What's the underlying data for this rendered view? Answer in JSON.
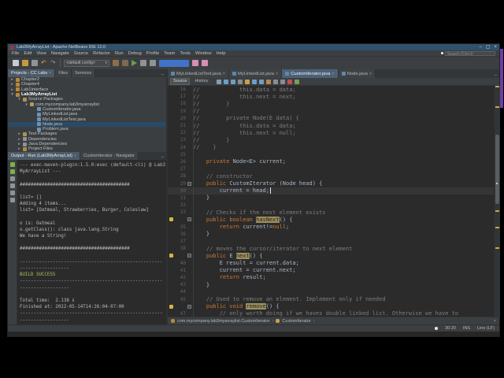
{
  "window": {
    "title": "Lab3MyArrayList - Apache NetBeans IDE 12.0"
  },
  "menu_bar": {
    "items": [
      "File",
      "Edit",
      "View",
      "Navigate",
      "Source",
      "Refactor",
      "Run",
      "Debug",
      "Profile",
      "Team",
      "Tools",
      "Window",
      "Help"
    ],
    "search_placeholder": "Search (Ctrl+I)"
  },
  "main_toolbar": {
    "config_value": "<default config>",
    "icons": [
      {
        "name": "new-file-icon",
        "color": "#c9cccd"
      },
      {
        "name": "open-project-icon",
        "color": "#c59a3f"
      },
      {
        "name": "save-all-icon",
        "color": "#8f9396"
      },
      {
        "name": "undo-icon",
        "color": "#d9a741",
        "glyph": "↶"
      },
      {
        "name": "redo-icon",
        "color": "#8f9396",
        "glyph": "↷"
      },
      {
        "name": "build-project-icon",
        "color": "#8d6e4a"
      },
      {
        "name": "clean-build-project-icon",
        "color": "#7d6a52"
      },
      {
        "name": "debug-project-icon",
        "color": "#8f9396"
      },
      {
        "name": "profile-project-icon",
        "color": "#8f9396"
      },
      {
        "name": "profiler-snapshot-icon",
        "color": "#d58fb4"
      },
      {
        "name": "reset-profiler-results-icon",
        "color": "#d58fb4"
      }
    ]
  },
  "left_panel": {
    "tabs": [
      {
        "label": "Projects - CC Labs",
        "close": true,
        "active": true
      },
      {
        "label": "Files",
        "close": false,
        "active": false
      },
      {
        "label": "Services",
        "close": false,
        "active": false
      }
    ],
    "tree": [
      {
        "label": "Chapter2",
        "indent": 0,
        "exp": "c",
        "icon": "project",
        "color": "#b8873f"
      },
      {
        "label": "Chapter4",
        "indent": 0,
        "exp": "c",
        "icon": "project",
        "color": "#b8873f"
      },
      {
        "label": "Lab1Interface",
        "indent": 0,
        "exp": "c",
        "icon": "project",
        "color": "#b8873f"
      },
      {
        "label": "Lab3MyArrayList",
        "indent": 0,
        "exp": "e",
        "icon": "project",
        "color": "#b8873f",
        "bold": true
      },
      {
        "label": "Source Packages",
        "indent": 1,
        "exp": "e",
        "icon": "package-root",
        "color": "#ad9350"
      },
      {
        "label": "com.mycompany.lab3myarraylist",
        "indent": 2,
        "exp": "e",
        "icon": "package",
        "color": "#b49a55"
      },
      {
        "label": "CustomIterator.java",
        "indent": 3,
        "exp": "n",
        "icon": "java-file",
        "color": "#6d93b5"
      },
      {
        "label": "MyLinkedList.java",
        "indent": 3,
        "exp": "n",
        "icon": "java-file",
        "color": "#6d93b5"
      },
      {
        "label": "MyLinkedListTest.java",
        "indent": 3,
        "exp": "n",
        "icon": "java-file",
        "color": "#6d93b5"
      },
      {
        "label": "Node.java",
        "indent": 3,
        "exp": "n",
        "icon": "java-file",
        "color": "#6d93b5",
        "selected": true
      },
      {
        "label": "Problem.java",
        "indent": 3,
        "exp": "n",
        "icon": "java-file",
        "color": "#6d93b5"
      },
      {
        "label": "Test Packages",
        "indent": 1,
        "exp": "c",
        "icon": "package-root",
        "color": "#ad9350"
      },
      {
        "label": "Dependencies",
        "indent": 1,
        "exp": "c",
        "icon": "dependencies",
        "color": "#8f9396"
      },
      {
        "label": "Java Dependencies",
        "indent": 1,
        "exp": "c",
        "icon": "dependencies",
        "color": "#8f9396"
      },
      {
        "label": "Project Files",
        "indent": 1,
        "exp": "c",
        "icon": "folder",
        "color": "#b8873f"
      }
    ]
  },
  "output_panel": {
    "tabs": [
      {
        "label": "Output - Run (Lab3MyArrayList)",
        "close": true,
        "active": true
      },
      {
        "label": "CustomIterator - Navigator",
        "close": false,
        "active": false
      }
    ],
    "toolbar_icons": [
      {
        "name": "rerun-icon",
        "color": "#7db04a"
      },
      {
        "name": "rerun-with-different-params-icon",
        "color": "#7db04a"
      },
      {
        "name": "stop-build-icon",
        "color": "#8f9396"
      },
      {
        "name": "clear-output-icon",
        "color": "#8f9396"
      },
      {
        "name": "filter-output-icon",
        "color": "#8f9396"
      },
      {
        "name": "output-settings-icon",
        "color": "#8f9396"
      }
    ],
    "lines": [
      {
        "t": "--- exec-maven-plugin:1.5.0:exec (default-cli) @ Lab3"
      },
      {
        "t": "MyArrayList ---"
      },
      {
        "t": ""
      },
      {
        "t": "########################################"
      },
      {
        "t": ""
      },
      {
        "t": "list= []"
      },
      {
        "t": "Adding 4 items..."
      },
      {
        "t": "list= [Oatmeal, Strawberries, Burger, Coleslaw]"
      },
      {
        "t": ""
      },
      {
        "t": "o is: Oatmeal"
      },
      {
        "t": "o.getClass(): class java.lang.String"
      },
      {
        "t": "We have a String!"
      },
      {
        "t": ""
      },
      {
        "t": "########################################"
      },
      {
        "t": ""
      },
      {
        "t": "----------------------------------------------------"
      },
      {
        "t": "------------------"
      },
      {
        "t": "BUILD SUCCESS",
        "c": "success"
      },
      {
        "t": "----------------------------------------------------"
      },
      {
        "t": "------------------"
      },
      {
        "t": ""
      },
      {
        "t": "Total time:  2.138 s"
      },
      {
        "t": "Finished at: 2022-05-14T14:26:04-07:00"
      },
      {
        "t": "----------------------------------------------------"
      },
      {
        "t": "------------------"
      }
    ]
  },
  "editor": {
    "tabs": [
      {
        "label": "MyLinkedListTest.java",
        "close": true,
        "active": false
      },
      {
        "label": "MyLinkedList.java",
        "close": true,
        "active": false
      },
      {
        "label": "CustomIterator.java",
        "close": true,
        "active": true
      },
      {
        "label": "Node.java",
        "close": true,
        "active": false
      }
    ],
    "toolbar": {
      "source_label": "Source",
      "history_label": "History",
      "icons": [
        {
          "name": "last-edit-icon",
          "color": "#7aa0b8"
        },
        {
          "name": "jump-back-icon",
          "color": "#6f9ec0"
        },
        {
          "name": "jump-forward-icon",
          "color": "#6f9ec0"
        },
        {
          "name": "find-selection-icon",
          "color": "#8a8d8f"
        },
        {
          "name": "toggle-highlight-icon",
          "color": "#caa04a"
        },
        {
          "name": "previous-bookmark-icon",
          "color": "#6f9ec0"
        },
        {
          "name": "next-bookmark-icon",
          "color": "#6f9ec0"
        },
        {
          "name": "toggle-bookmark-icon",
          "color": "#b8874a"
        },
        {
          "name": "shift-left-icon",
          "color": "#8a8d8f"
        },
        {
          "name": "shift-right-icon",
          "color": "#8a8d8f"
        },
        {
          "name": "start-macro-icon",
          "color": "#c05050"
        },
        {
          "name": "stop-macro-icon",
          "color": "#7a9a5a"
        }
      ]
    },
    "code": [
      {
        "n": 16,
        "g": "num",
        "fold": false,
        "caret": false,
        "s": [
          [
            "//            this.data = data;",
            "c"
          ]
        ]
      },
      {
        "n": 17,
        "g": "num",
        "fold": false,
        "caret": false,
        "s": [
          [
            "//            this.next = next;",
            "c"
          ]
        ]
      },
      {
        "n": 18,
        "g": "num",
        "fold": false,
        "caret": false,
        "s": [
          [
            "//        }",
            "c"
          ]
        ]
      },
      {
        "n": 19,
        "g": "num",
        "fold": false,
        "caret": false,
        "s": [
          [
            "//",
            "c"
          ]
        ]
      },
      {
        "n": 20,
        "g": "num",
        "fold": false,
        "caret": false,
        "s": [
          [
            "//        private Node(E data) {",
            "c"
          ]
        ]
      },
      {
        "n": 21,
        "g": "num",
        "fold": false,
        "caret": false,
        "s": [
          [
            "//            this.data = data;",
            "c"
          ]
        ]
      },
      {
        "n": 22,
        "g": "num",
        "fold": false,
        "caret": false,
        "s": [
          [
            "//            this.next = null;",
            "c"
          ]
        ]
      },
      {
        "n": 23,
        "g": "num",
        "fold": false,
        "caret": false,
        "s": [
          [
            "//        }",
            "c"
          ]
        ]
      },
      {
        "n": 24,
        "g": "num",
        "fold": false,
        "caret": false,
        "s": [
          [
            "//    }",
            "c"
          ]
        ]
      },
      {
        "n": 25,
        "g": "num",
        "fold": false,
        "caret": false,
        "s": []
      },
      {
        "n": 26,
        "g": "num",
        "fold": false,
        "caret": false,
        "s": [
          [
            "    ",
            "p"
          ],
          [
            "private",
            "k"
          ],
          [
            " Node<E> current;",
            "p"
          ]
        ]
      },
      {
        "n": 27,
        "g": "num",
        "fold": false,
        "caret": false,
        "s": []
      },
      {
        "n": 28,
        "g": "num",
        "fold": false,
        "caret": false,
        "s": [
          [
            "    // constructor",
            "c"
          ]
        ]
      },
      {
        "n": 29,
        "g": "num",
        "fold": true,
        "caret": false,
        "s": [
          [
            "    ",
            "p"
          ],
          [
            "public",
            "k"
          ],
          [
            " CustomIterator (Node head) {",
            "p"
          ]
        ]
      },
      {
        "n": 30,
        "g": "num",
        "fold": false,
        "caret": true,
        "s": [
          [
            "        current = head;",
            "p"
          ]
        ]
      },
      {
        "n": 31,
        "g": "num",
        "fold": false,
        "caret": false,
        "s": [
          [
            "    }",
            "p"
          ]
        ]
      },
      {
        "n": 32,
        "g": "num",
        "fold": false,
        "caret": false,
        "s": []
      },
      {
        "n": 33,
        "g": "num",
        "fold": false,
        "caret": false,
        "s": [
          [
            "    // Checks if the next element exists",
            "c"
          ]
        ]
      },
      {
        "n": 34,
        "g": "warn",
        "fold": true,
        "caret": false,
        "s": [
          [
            "    ",
            "p"
          ],
          [
            "public",
            "k"
          ],
          [
            " ",
            "p"
          ],
          [
            "boolean",
            "k"
          ],
          [
            " ",
            "p"
          ],
          [
            "hasNext",
            "h"
          ],
          [
            "() {",
            "p"
          ]
        ]
      },
      {
        "n": 35,
        "g": "num",
        "fold": false,
        "caret": false,
        "s": [
          [
            "        ",
            "p"
          ],
          [
            "return",
            "k"
          ],
          [
            " current!=",
            "p"
          ],
          [
            "null",
            "k"
          ],
          [
            ";",
            "p"
          ]
        ]
      },
      {
        "n": 36,
        "g": "num",
        "fold": false,
        "caret": false,
        "s": [
          [
            "    }",
            "p"
          ]
        ]
      },
      {
        "n": 37,
        "g": "num",
        "fold": false,
        "caret": false,
        "s": []
      },
      {
        "n": 38,
        "g": "num",
        "fold": false,
        "caret": false,
        "s": [
          [
            "    // moves the cursor/iterator to next element",
            "c"
          ]
        ]
      },
      {
        "n": 39,
        "g": "warn",
        "fold": true,
        "caret": false,
        "s": [
          [
            "    ",
            "p"
          ],
          [
            "public",
            "k"
          ],
          [
            " E ",
            "p"
          ],
          [
            "next",
            "h"
          ],
          [
            "() {",
            "p"
          ]
        ]
      },
      {
        "n": 40,
        "g": "num",
        "fold": false,
        "caret": false,
        "s": [
          [
            "        E result = current.data;",
            "p"
          ]
        ]
      },
      {
        "n": 41,
        "g": "num",
        "fold": false,
        "caret": false,
        "s": [
          [
            "        current = current.next;",
            "p"
          ]
        ]
      },
      {
        "n": 42,
        "g": "num",
        "fold": false,
        "caret": false,
        "s": [
          [
            "        ",
            "p"
          ],
          [
            "return",
            "k"
          ],
          [
            " result;",
            "p"
          ]
        ]
      },
      {
        "n": 43,
        "g": "num",
        "fold": false,
        "caret": false,
        "s": [
          [
            "    }",
            "p"
          ]
        ]
      },
      {
        "n": 44,
        "g": "num",
        "fold": false,
        "caret": false,
        "s": []
      },
      {
        "n": 45,
        "g": "num",
        "fold": false,
        "caret": false,
        "s": [
          [
            "    // Used to remove an element. Implement only if needed",
            "c"
          ]
        ]
      },
      {
        "n": 46,
        "g": "warn",
        "fold": true,
        "caret": false,
        "s": [
          [
            "    ",
            "p"
          ],
          [
            "public",
            "k"
          ],
          [
            " ",
            "p"
          ],
          [
            "void",
            "k"
          ],
          [
            " ",
            "p"
          ],
          [
            "remove",
            "h"
          ],
          [
            "() {",
            "p"
          ]
        ]
      },
      {
        "n": 47,
        "g": "num",
        "fold": false,
        "caret": false,
        "s": [
          [
            "        // only worth doing if we haves double linked list. Otherwise we have to",
            "c"
          ]
        ]
      }
    ],
    "breadcrumb": [
      {
        "label": "com.mycompany.lab3myarraylist.CustomIterator",
        "icon": "class-icon",
        "color": "#b8873f"
      },
      {
        "label": "CustomIterator",
        "icon": "constructor-icon",
        "color": "#caa04a"
      }
    ],
    "error_stripe": {
      "marks": [
        0.0,
        0.09,
        0.36,
        0.42,
        0.54,
        0.61,
        0.7
      ],
      "thumb": {
        "top": 0.21,
        "height": 0.3
      },
      "caret_dot": 0.42
    }
  },
  "status_bar": {
    "caret_position": "30:20",
    "insert_mode": "INS",
    "line_separator": "Line (LF)"
  },
  "colors": {
    "titlebar": "#31506b",
    "chrome": "#3c3f41",
    "editor_bg": "#2b2b2b",
    "keyword": "#cc7832",
    "comment": "#7d7d7d",
    "occurrence_highlight": "#9d8f5f",
    "build_success": "#a8c45c",
    "selection_blue": "#3f74c9",
    "warning_yellow": "#d3b63e",
    "wallpaper_purple": "#6b3fa0"
  }
}
